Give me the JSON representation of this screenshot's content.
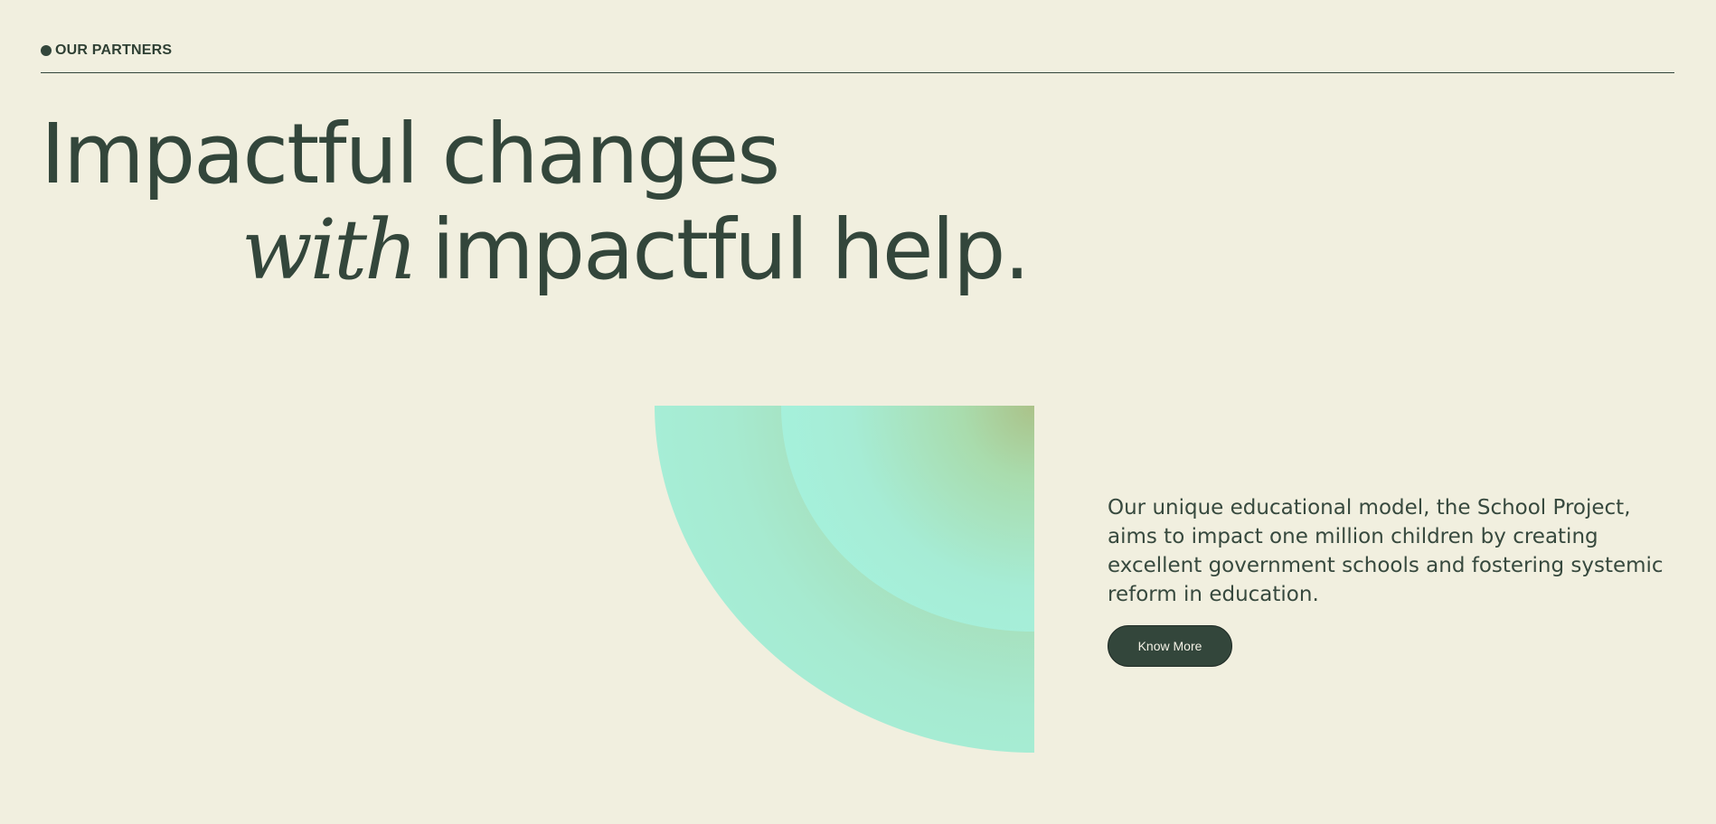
{
  "section": {
    "label": "OUR PARTNERS"
  },
  "hero": {
    "line1": "Impactful changes",
    "line2_italic": "with",
    "line2_rest": "impactful help."
  },
  "description": {
    "text": "Our unique educational model, the School Project, aims to impact one million children by creating excellent government schools and fostering systemic reform in education.",
    "button_label": "Know More"
  },
  "colors": {
    "background": "#f1efdf",
    "text": "#33463b",
    "button": "#33463b",
    "art_light": "#a6efd8",
    "art_mid": "#a9cf9e"
  },
  "icons": {
    "label_dot": "dot-icon",
    "artwork": "concentric-quarter-circle-art"
  }
}
